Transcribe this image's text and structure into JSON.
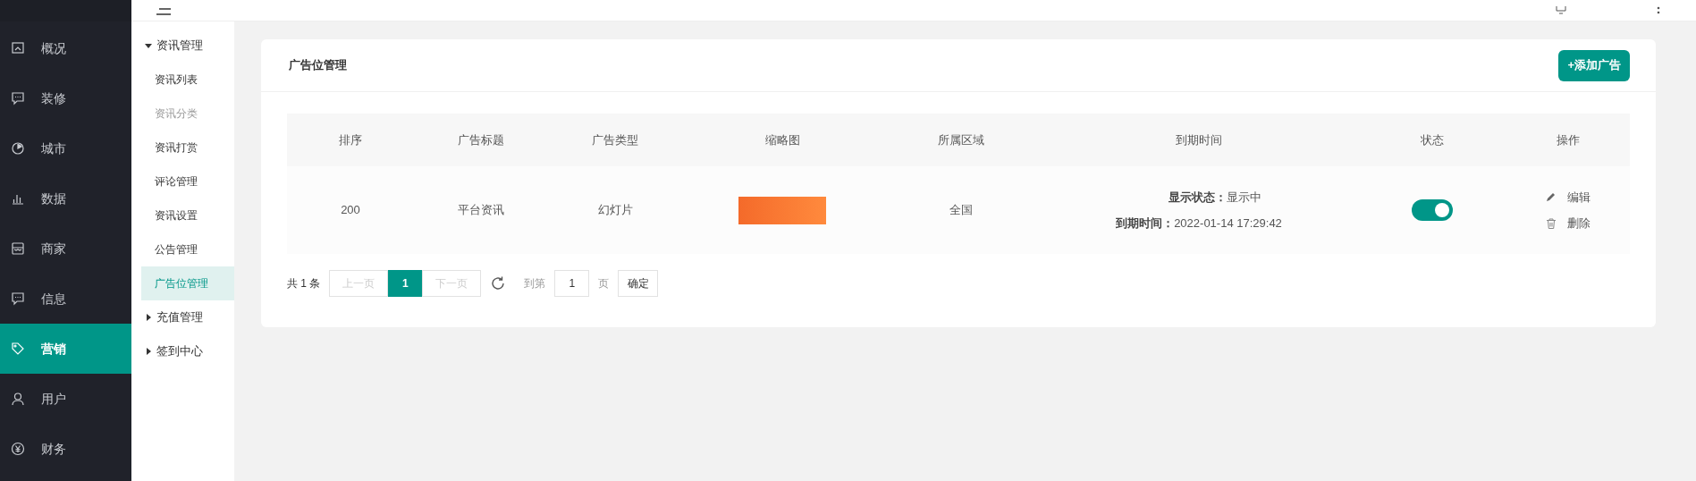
{
  "sidebar": {
    "items": [
      {
        "label": "概况",
        "kind": "overview",
        "selected": false
      },
      {
        "label": "装修",
        "kind": "chat",
        "selected": false
      },
      {
        "label": "城市",
        "kind": "gauge",
        "selected": false
      },
      {
        "label": "数据",
        "kind": "bars",
        "selected": false
      },
      {
        "label": "商家",
        "kind": "store",
        "selected": false
      },
      {
        "label": "信息",
        "kind": "chat",
        "selected": false
      },
      {
        "label": "营销",
        "kind": "tag",
        "selected": true
      },
      {
        "label": "用户",
        "kind": "user",
        "selected": false
      },
      {
        "label": "财务",
        "kind": "yen",
        "selected": false
      }
    ]
  },
  "submenu": [
    {
      "label": "资讯管理",
      "expanded": true,
      "children": [
        {
          "label": "资讯列表",
          "selected": false,
          "disabled": false
        },
        {
          "label": "资讯分类",
          "selected": false,
          "disabled": true
        },
        {
          "label": "资讯打赏",
          "selected": false,
          "disabled": false
        },
        {
          "label": "评论管理",
          "selected": false,
          "disabled": false
        },
        {
          "label": "资讯设置",
          "selected": false,
          "disabled": false
        },
        {
          "label": "公告管理",
          "selected": false,
          "disabled": false
        },
        {
          "label": "广告位管理",
          "selected": true,
          "disabled": false
        }
      ]
    },
    {
      "label": "充值管理",
      "expanded": false
    },
    {
      "label": "签到中心",
      "expanded": false
    }
  ],
  "card": {
    "title": "广告位管理",
    "add_button": "+添加广告"
  },
  "table": {
    "columns": [
      "排序",
      "广告标题",
      "广告类型",
      "缩略图",
      "所属区域",
      "到期时间",
      "状态",
      "操作"
    ],
    "rows": [
      {
        "sort": "200",
        "title": "平台资讯",
        "type": "幻灯片",
        "region": "全国",
        "status_label": "显示状态：",
        "status_value": "显示中",
        "expire_label": "到期时间：",
        "expire_value": "2022-01-14 17:29:42",
        "on": true,
        "edit": "编辑",
        "delete": "删除"
      }
    ]
  },
  "pagination": {
    "total": "共 1 条",
    "prev": "上一页",
    "pages": [
      {
        "label": "1",
        "selected": true
      }
    ],
    "next": "下一页",
    "goto": "到第",
    "page_value": "1",
    "page_suffix": "页",
    "confirm": "确定"
  }
}
